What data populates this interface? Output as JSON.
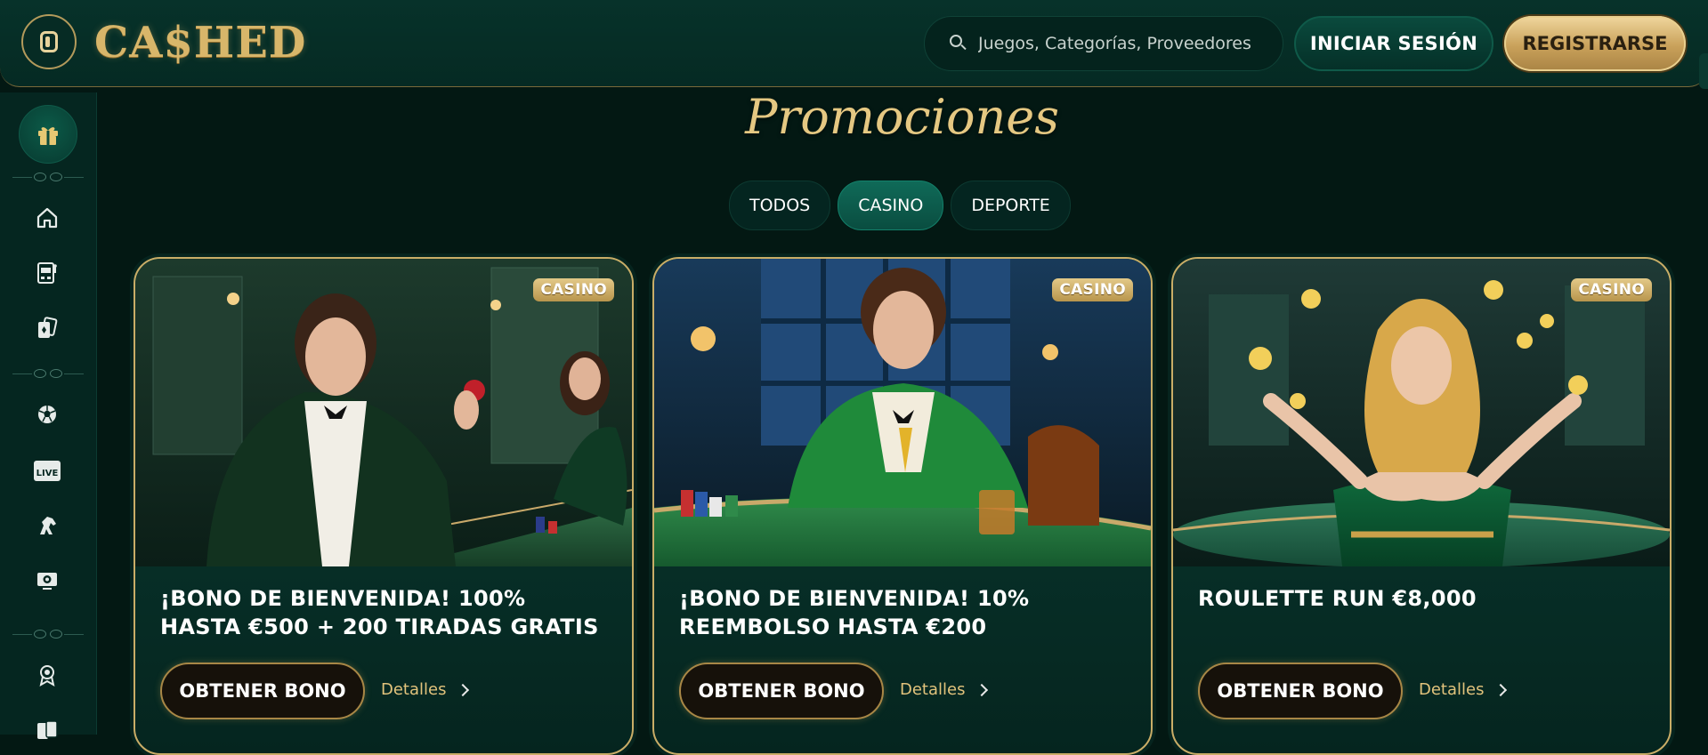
{
  "header": {
    "logo_text": "CA$HED",
    "search_placeholder": "Juegos, Categorías, Proveedores",
    "login_label": "INICIAR SESIÓN",
    "register_label": "REGISTRARSE"
  },
  "sidebar": {
    "icons": [
      "gift-icon",
      "home-icon",
      "slot-machine-icon",
      "cards-icon",
      "football-icon",
      "live-icon",
      "horse-racing-icon",
      "virtual-sports-icon",
      "badge-icon",
      "card-games-icon"
    ],
    "live_text": "LIVE"
  },
  "page": {
    "title": "Promociones",
    "tabs": [
      {
        "label": "TODOS",
        "active": false
      },
      {
        "label": "CASINO",
        "active": true
      },
      {
        "label": "DEPORTE",
        "active": false
      }
    ]
  },
  "cards": [
    {
      "badge": "CASINO",
      "title": "¡BONO DE BIENVENIDA! 100% HASTA €500 + 200 TIRADAS GRATIS",
      "button": "OBTENER BONO",
      "details": "Detalles"
    },
    {
      "badge": "CASINO",
      "title": "¡BONO DE BIENVENIDA! 10% REEMBOLSO HASTA €200",
      "button": "OBTENER BONO",
      "details": "Detalles"
    },
    {
      "badge": "CASINO",
      "title": "ROULETTE RUN €8,000",
      "button": "OBTENER BONO",
      "details": "Detalles"
    }
  ],
  "colors": {
    "accent_gold": "#d8b66a",
    "background": "#031813",
    "active_tab": "#0f6a58"
  }
}
